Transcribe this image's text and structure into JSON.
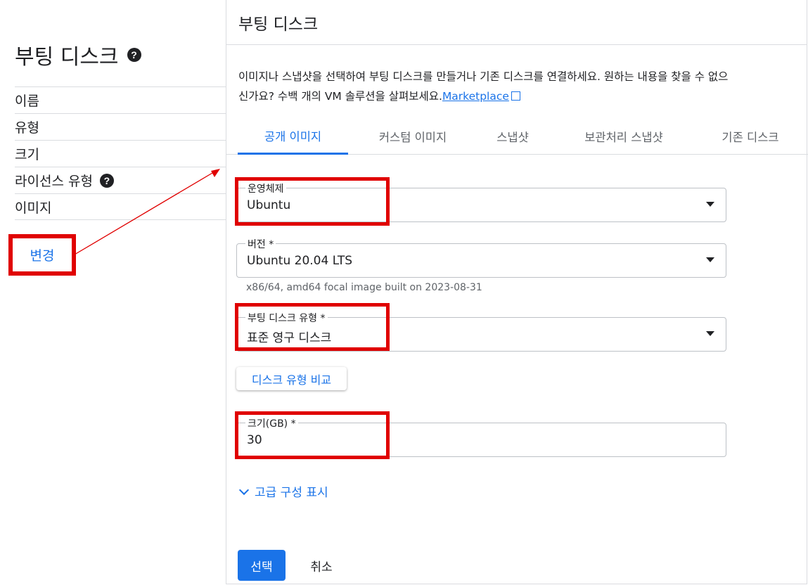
{
  "left": {
    "title": "부팅 디스크",
    "help_icon": "?",
    "rows": [
      {
        "label": "이름"
      },
      {
        "label": "유형"
      },
      {
        "label": "크기"
      },
      {
        "label": "라이선스 유형",
        "help": "?"
      },
      {
        "label": "이미지"
      }
    ],
    "change_label": "변경"
  },
  "panel": {
    "title": "부팅 디스크",
    "description": "이미지나 스냅샷을 선택하여 부팅 디스크를 만들거나 기존 디스크를 연결하세요. 원하는 내용을 찾을 수 없으신가요? 수백 개의 VM 솔루션을 살펴보세요.",
    "marketplace_link": "Marketplace",
    "tabs": [
      {
        "label": "공개 이미지",
        "active": true
      },
      {
        "label": "커스텀 이미지"
      },
      {
        "label": "스냅샷"
      },
      {
        "label": "보관처리 스냅샷"
      },
      {
        "label": "기존 디스크"
      }
    ],
    "os": {
      "label": "운영체제",
      "value": "Ubuntu"
    },
    "version": {
      "label": "버전 *",
      "value": "Ubuntu 20.04 LTS",
      "hint": "x86/64, amd64 focal image built on 2023-08-31"
    },
    "disk_type": {
      "label": "부팅 디스크 유형 *",
      "value": "표준 영구 디스크"
    },
    "compare_label": "디스크 유형 비교",
    "size": {
      "label": "크기(GB) *",
      "value": "30"
    },
    "advanced_label": "고급 구성 표시",
    "select_label": "선택",
    "cancel_label": "취소"
  },
  "colors": {
    "accent": "#1a73e8",
    "highlight": "#e00000"
  }
}
